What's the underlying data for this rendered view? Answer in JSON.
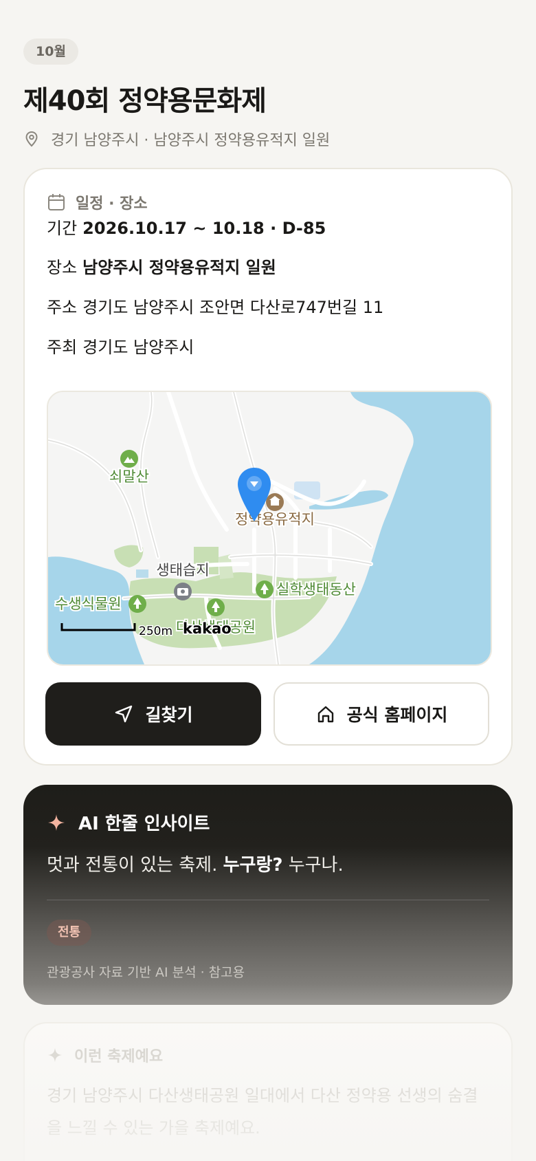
{
  "header": {
    "month_badge": "10월",
    "title": "제40회 정약용문화제",
    "location": "경기 남양주시 · 남양주시 정약용유적지 일원"
  },
  "schedule_card": {
    "heading": "일정 · 장소",
    "period": {
      "label": "기간",
      "value": "2026.10.17 ~ 10.18 · D-85"
    },
    "venue": {
      "label": "장소",
      "value": "남양주시 정약용유적지 일원"
    },
    "address": {
      "label": "주소",
      "value": "경기도 남양주시 조안면 다산로747번길 11"
    },
    "host": {
      "label": "주최",
      "value": "경기도 남양주시"
    },
    "map": {
      "labels": {
        "mountain": "쇠말산",
        "site": "정약용유적지",
        "wetland": "생태습지",
        "aquatic": "수생식물원",
        "park": "다산생태공원",
        "hill": "실학생태동산"
      },
      "scale": "250m",
      "provider": "kakao"
    },
    "buttons": {
      "directions": "길찾기",
      "homepage": "공식 홈페이지"
    }
  },
  "ai_insight": {
    "heading": "AI 한줄 인사이트",
    "text_part1": "멋과 전통이 있는 축제.",
    "text_bold": "누구랑?",
    "text_part2": "누구나.",
    "tag": "전통",
    "footnote": "관광공사 자료 기반 AI 분석 · 참고용"
  },
  "description": {
    "heading": "이런 축제예요",
    "text": "경기 남양주시 다산생태공원 일대에서 다산 정약용 선생의 숨결을 느낄 수 있는 가을 축제예요."
  },
  "colors": {
    "background": "#f6f5f2",
    "primary_dark": "#1f1e1b",
    "accent_coral": "#f3b4a0",
    "map_water": "#a6d5ea",
    "map_green": "#c8dfb4",
    "marker_blue": "#2f8cf0"
  }
}
